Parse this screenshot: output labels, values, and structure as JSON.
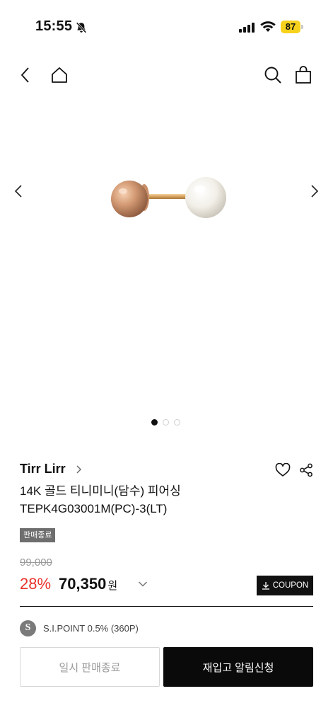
{
  "status_bar": {
    "time": "15:55",
    "battery": "87",
    "battery_color": "#f7d21d",
    "icons": [
      "bell-slash-icon",
      "cellular-signal-icon",
      "wifi-icon",
      "battery-icon"
    ]
  },
  "nav": {
    "icons": [
      "back-chevron-icon",
      "home-icon",
      "search-icon",
      "shopping-bag-icon"
    ]
  },
  "gallery": {
    "total_images": 3,
    "active_index": 0,
    "icons": [
      "chevron-left-icon",
      "chevron-right-icon"
    ]
  },
  "product": {
    "brand": "Tirr Lirr",
    "title": "14K 골드 티니미니(담수) 피어싱 TEPK4G03001M(PC)-3(LT)",
    "badge": "판매종료",
    "original_price": "99,000",
    "discount": "28%",
    "sale_price": "70,350",
    "currency": "원",
    "coupon_label": "COUPON",
    "point_icon_letter": "S",
    "point_text": "S.I.POINT 0.5% (360P)"
  },
  "actions": {
    "soldout_label": "일시 판매종료",
    "restock_label": "재입고 알림신청"
  },
  "colors": {
    "discount": "#e8322b",
    "primary_button": "#0a0a0a",
    "badge": "#6e6e6e"
  }
}
